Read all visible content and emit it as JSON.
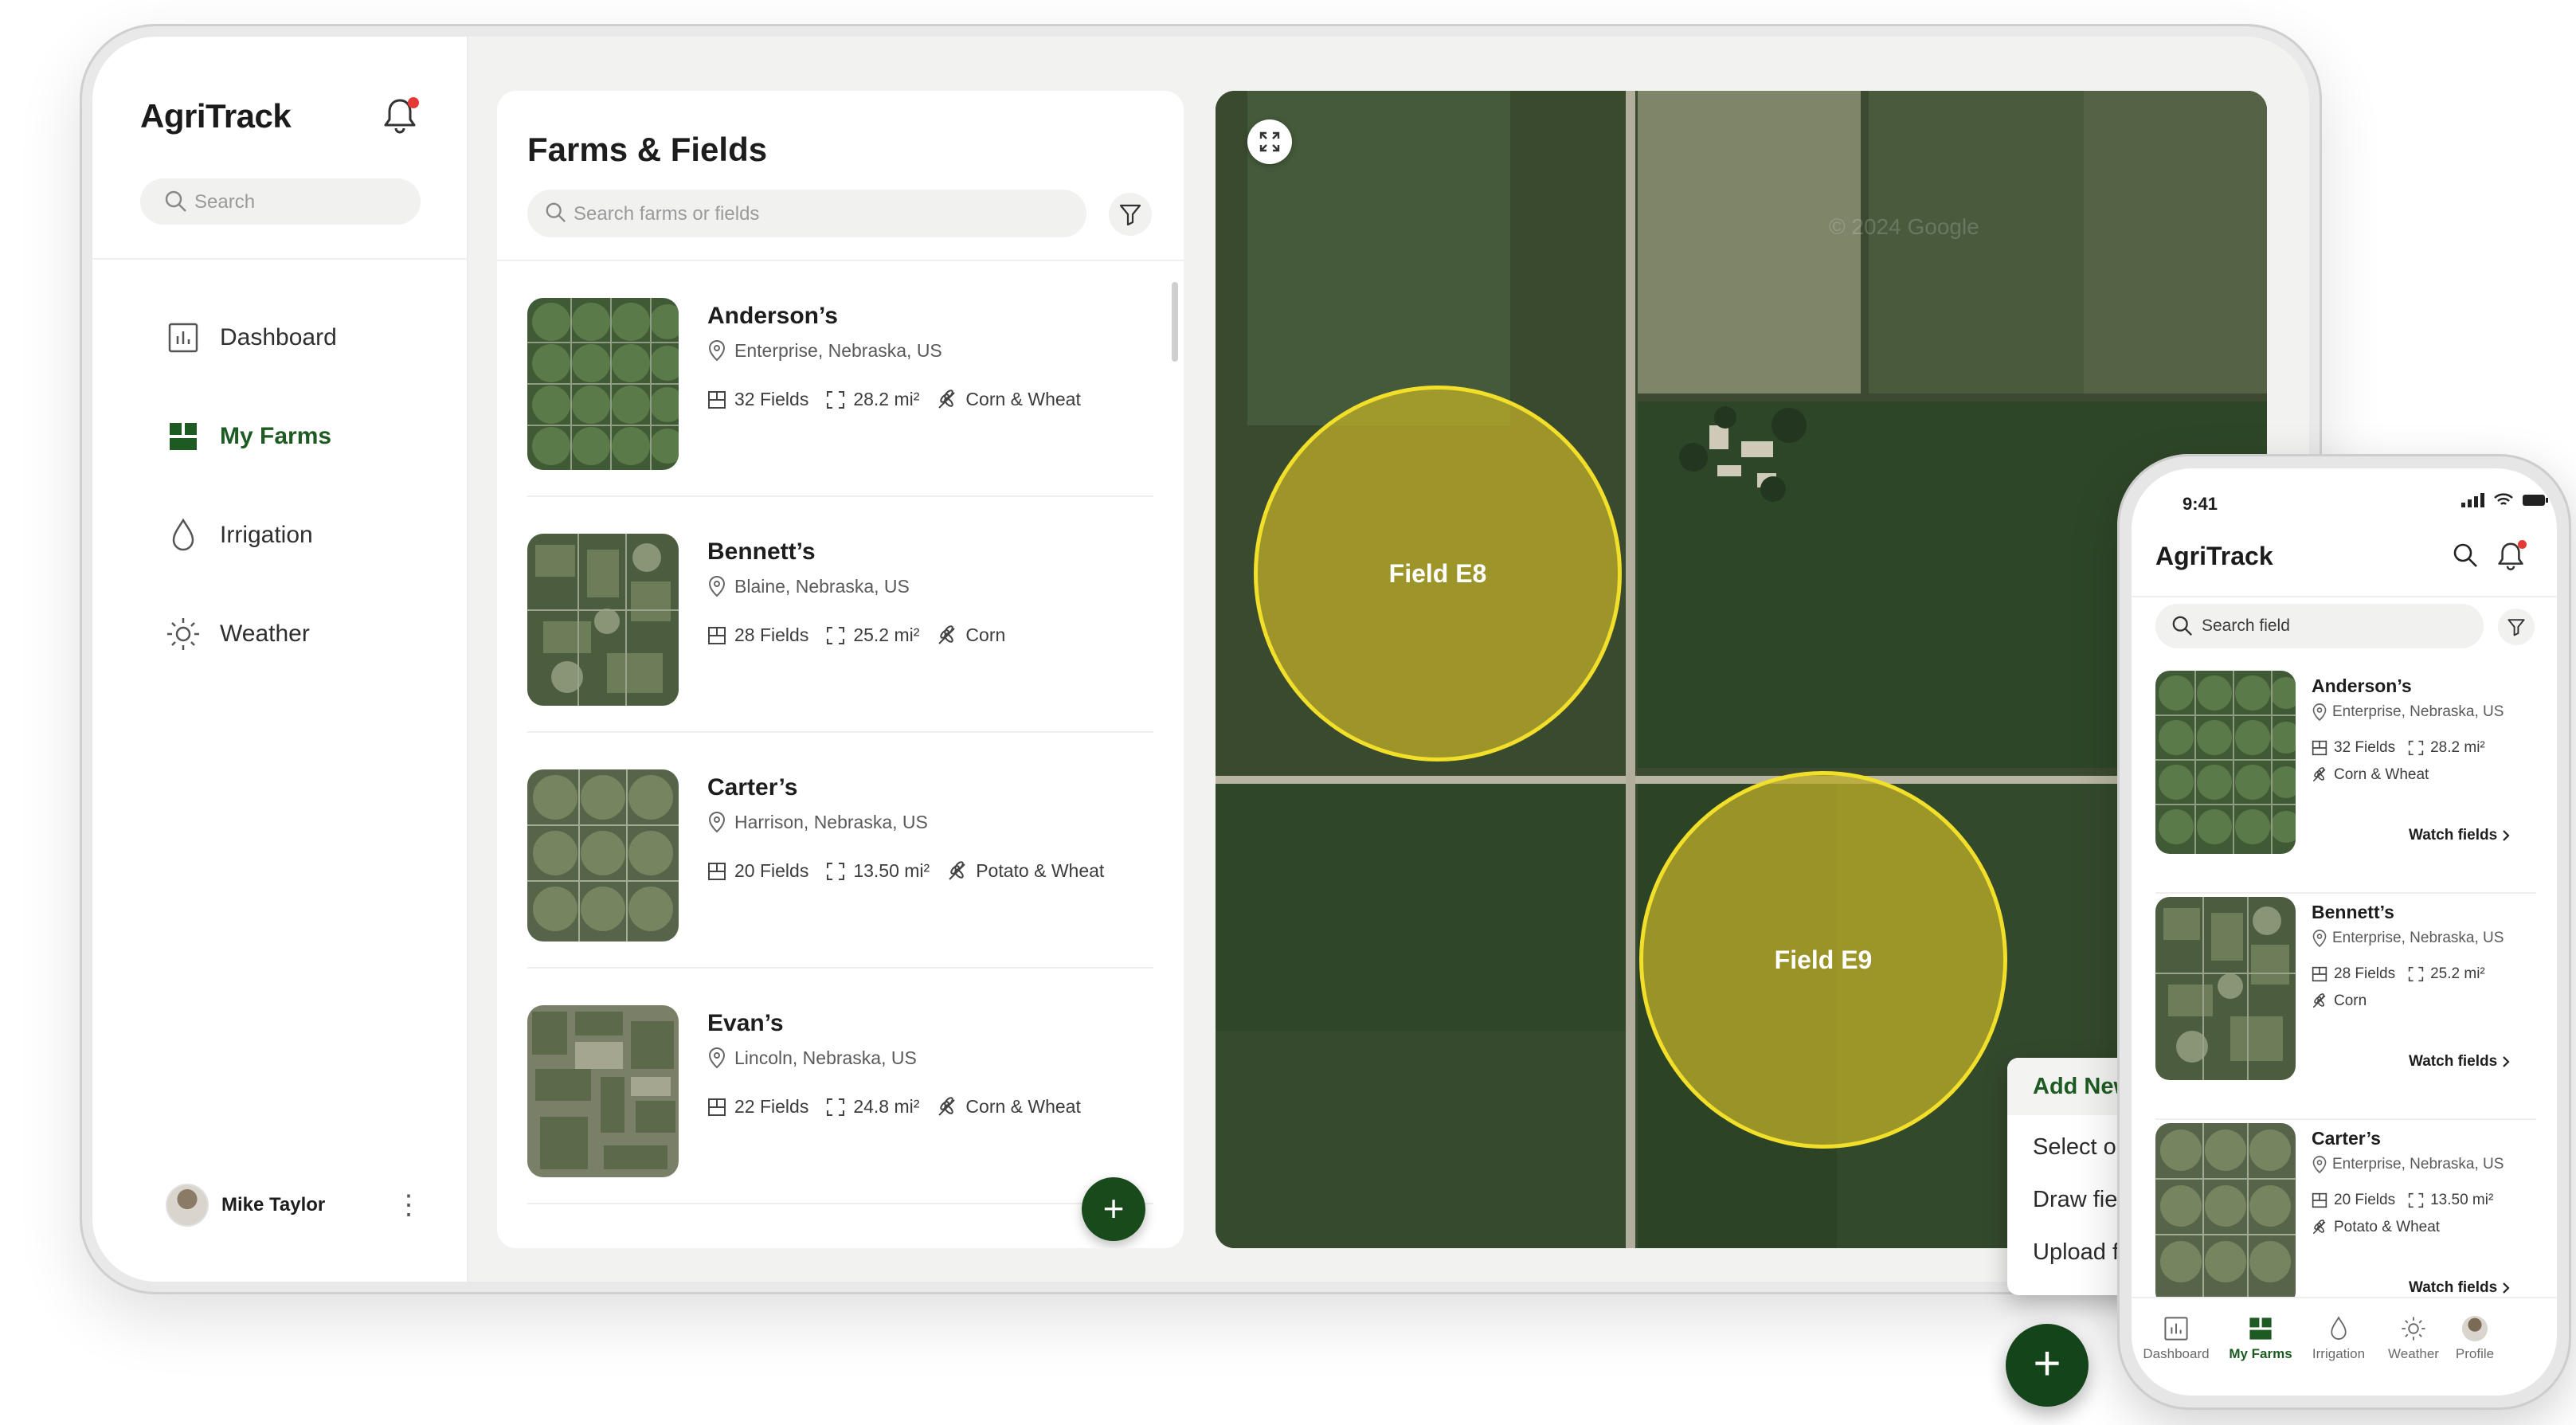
{
  "app": {
    "title": "AgriTrack",
    "accent": "#1e5b23"
  },
  "sidebar": {
    "search_placeholder": "Search",
    "items": [
      {
        "label": "Dashboard",
        "icon": "dashboard-icon"
      },
      {
        "label": "My Farms",
        "icon": "farms-icon",
        "active": true
      },
      {
        "label": "Irrigation",
        "icon": "droplet-icon"
      },
      {
        "label": "Weather",
        "icon": "sun-icon"
      }
    ],
    "user": {
      "name": "Mike Taylor"
    }
  },
  "list": {
    "title": "Farms & Fields",
    "search_placeholder": "Search farms or fields",
    "farms": [
      {
        "name": "Anderson’s",
        "location": "Enterprise, Nebraska, US",
        "fields": "32 Fields",
        "area": "28.2 mi²",
        "crops": "Corn & Wheat"
      },
      {
        "name": "Bennett’s",
        "location": "Blaine, Nebraska, US",
        "fields": "28 Fields",
        "area": "25.2 mi²",
        "crops": "Corn"
      },
      {
        "name": "Carter’s",
        "location": "Harrison, Nebraska, US",
        "fields": "20 Fields",
        "area": "13.50 mi²",
        "crops": "Potato & Wheat"
      },
      {
        "name": "Evan’s",
        "location": "Lincoln, Nebraska, US",
        "fields": "22 Fields",
        "area": "24.8 mi²",
        "crops": "Corn & Wheat"
      }
    ],
    "fab_label": "+"
  },
  "map": {
    "fields": [
      {
        "label": "Field E8"
      },
      {
        "label": "Field E9"
      }
    ],
    "watermark": "© 2024 Google"
  },
  "menu": {
    "title": "Add New Field",
    "items": [
      "Select on map",
      "Draw field",
      "Upload file"
    ],
    "fab_label": "+"
  },
  "phone": {
    "time": "9:41",
    "title": "AgriTrack",
    "search_placeholder": "Search field",
    "farms": [
      {
        "name": "Anderson’s",
        "location": "Enterprise, Nebraska, US",
        "fields": "32 Fields",
        "area": "28.2 mi²",
        "crops": "Corn & Wheat",
        "action": "Watch fields"
      },
      {
        "name": "Bennett’s",
        "location": "Enterprise, Nebraska, US",
        "fields": "28 Fields",
        "area": "25.2 mi²",
        "crops": "Corn",
        "action": "Watch fields"
      },
      {
        "name": "Carter’s",
        "location": "Enterprise, Nebraska, US",
        "fields": "20 Fields",
        "area": "13.50 mi²",
        "crops": "Potato & Wheat",
        "action": "Watch fields"
      }
    ],
    "tabs": [
      {
        "label": "Dashboard"
      },
      {
        "label": "My Farms",
        "active": true
      },
      {
        "label": "Irrigation"
      },
      {
        "label": "Weather"
      },
      {
        "label": "Profile"
      }
    ]
  }
}
